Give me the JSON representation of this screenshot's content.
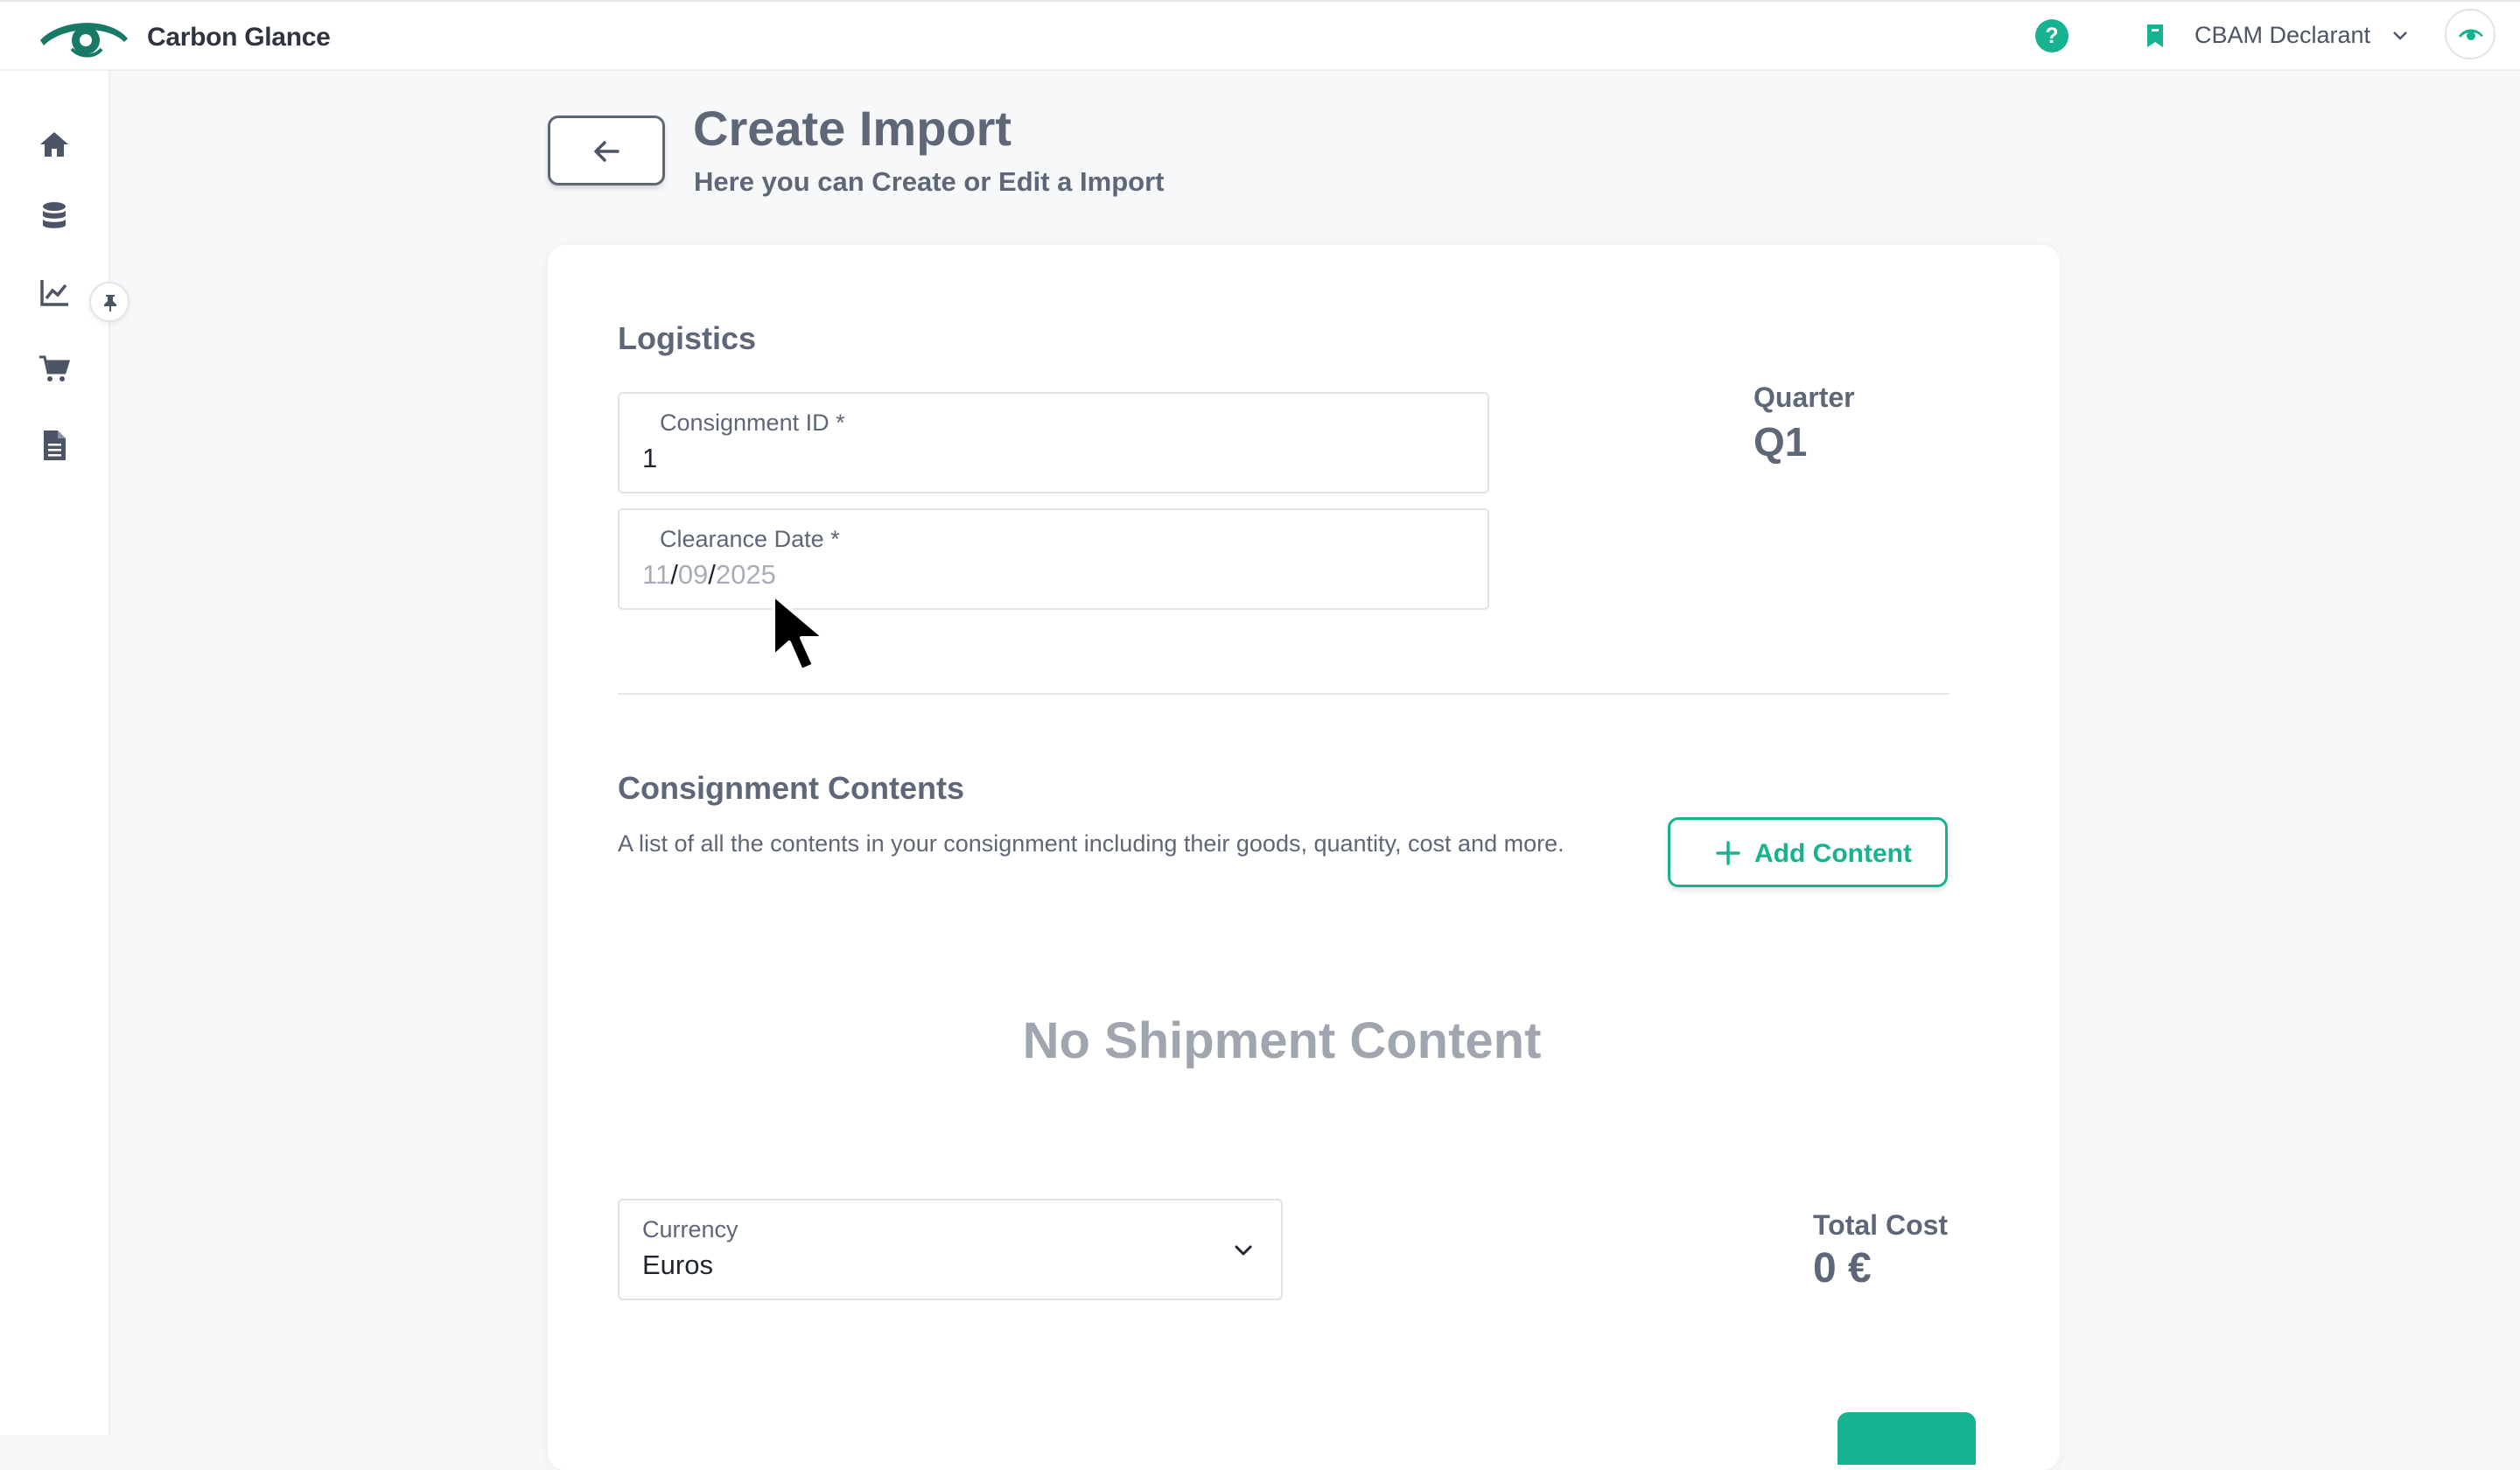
{
  "header": {
    "brand": "Carbon Glance",
    "help_icon_glyph": "?",
    "role_label": "CBAM Declarant",
    "icons": [
      "eye-logo-icon",
      "help-icon",
      "bookmark-icon",
      "chevron-down-icon",
      "avatar-eye-icon"
    ]
  },
  "sidebar": {
    "items": [
      {
        "name": "home-icon"
      },
      {
        "name": "database-icon"
      },
      {
        "name": "chart-line-icon"
      },
      {
        "name": "cart-icon"
      },
      {
        "name": "document-icon"
      }
    ],
    "pin_icon": "pin-icon"
  },
  "page": {
    "title": "Create Import",
    "subtitle": "Here you can Create or Edit a Import"
  },
  "logistics": {
    "title": "Logistics",
    "consignment_id": {
      "label": "Consignment ID *",
      "value": "1"
    },
    "clearance_date": {
      "label": "Clearance Date *",
      "day": "11",
      "month": "09",
      "year": "2025",
      "separator": "/"
    },
    "quarter_label": "Quarter",
    "quarter_value": "Q1"
  },
  "contents": {
    "title": "Consignment Contents",
    "description": "A list of all the contents in your consignment including their goods, quantity, cost and more.",
    "add_button_label": "Add Content",
    "empty_message": "No Shipment Content"
  },
  "currency": {
    "label": "Currency",
    "value": "Euros"
  },
  "total": {
    "label": "Total Cost",
    "value": "0 €"
  },
  "colors": {
    "accent": "#17b28f",
    "text": "#5d6778",
    "muted": "#a0a6b0"
  }
}
